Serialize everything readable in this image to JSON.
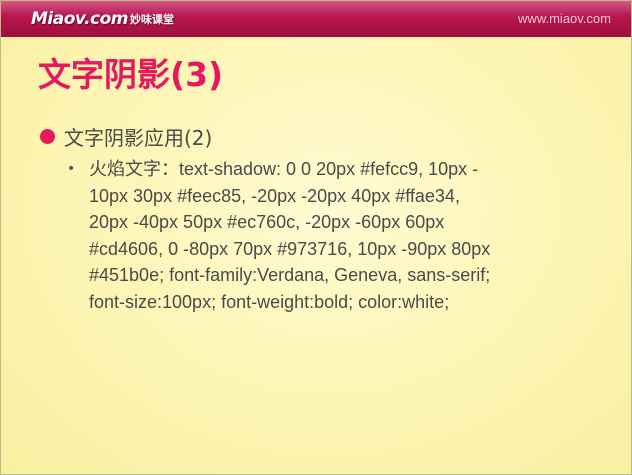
{
  "header": {
    "logo_text": "Miaov.com",
    "logo_cn": "妙味课堂",
    "site_url": "www.miaov.com"
  },
  "slide": {
    "title": "文字阴影(3)",
    "bullet": "文字阴影应用(2)",
    "sub_bullet_lines": [
      "火焰文字：text-shadow: 0 0 20px #fefcc9, 10px -",
      "10px 30px #feec85, -20px -20px 40px #ffae34,",
      "20px -40px 50px #ec760c, -20px -60px 60px",
      "#cd4606, 0 -80px 70px #973716, 10px -90px 80px",
      "#451b0e; font-family:Verdana, Geneva, sans-serif;",
      "font-size:100px; font-weight:bold; color:white;"
    ]
  },
  "colors": {
    "header": "#b3144a",
    "accent": "#e6195f",
    "background": "#fdf6b8",
    "body_text": "#4a4a4a"
  }
}
